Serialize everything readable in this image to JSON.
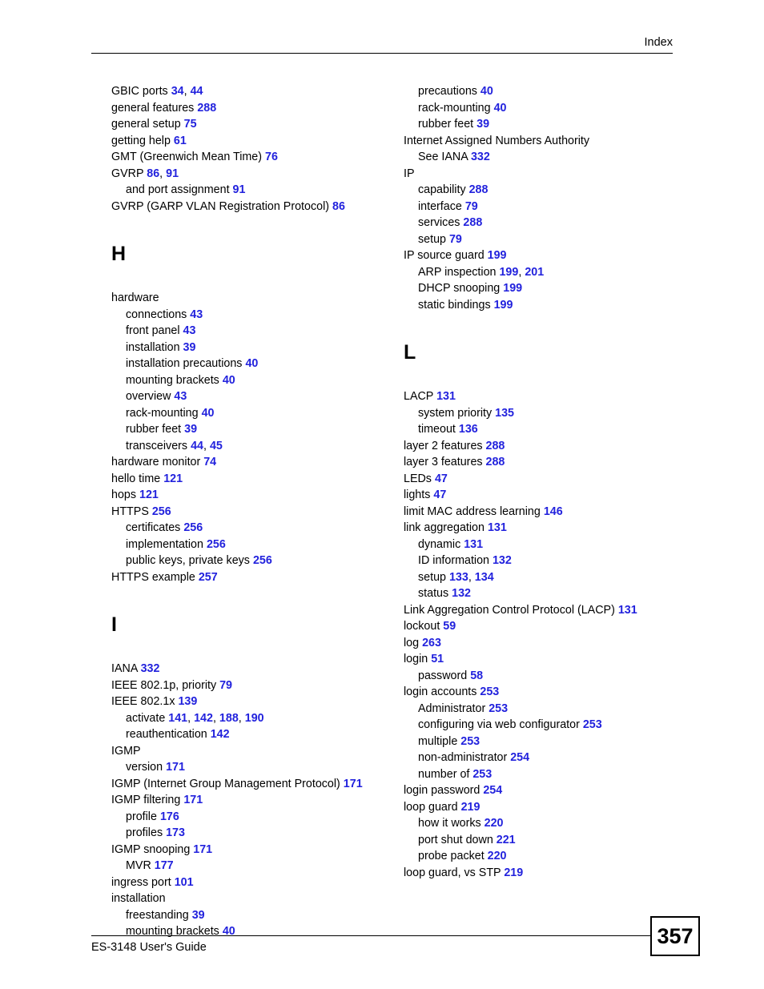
{
  "header": {
    "title": "Index"
  },
  "footer": {
    "guide_title": "ES-3148 User's Guide",
    "page_number": "357"
  },
  "colors": {
    "page_link": "#2222dd",
    "text": "#000000",
    "background": "#ffffff"
  },
  "columns": {
    "left": [
      {
        "type": "entries",
        "entries": [
          {
            "level": 0,
            "label": "GBIC ports",
            "pages": "34, 44"
          },
          {
            "level": 0,
            "label": "general features",
            "pages": "288"
          },
          {
            "level": 0,
            "label": "general setup",
            "pages": "75"
          },
          {
            "level": 0,
            "label": "getting help",
            "pages": "61"
          },
          {
            "level": 0,
            "label": "GMT (Greenwich Mean Time)",
            "pages": "76"
          },
          {
            "level": 0,
            "label": "GVRP",
            "pages": "86, 91"
          },
          {
            "level": 1,
            "label": "and port assignment",
            "pages": "91"
          },
          {
            "level": 0,
            "label": "GVRP (GARP VLAN Registration Protocol)",
            "pages": "86"
          }
        ]
      },
      {
        "type": "letter",
        "letter": "H"
      },
      {
        "type": "entries",
        "entries": [
          {
            "level": 0,
            "label": "hardware",
            "pages": ""
          },
          {
            "level": 1,
            "label": "connections",
            "pages": "43"
          },
          {
            "level": 1,
            "label": "front panel",
            "pages": "43"
          },
          {
            "level": 1,
            "label": "installation",
            "pages": "39"
          },
          {
            "level": 1,
            "label": "installation precautions",
            "pages": "40"
          },
          {
            "level": 1,
            "label": "mounting brackets",
            "pages": "40"
          },
          {
            "level": 1,
            "label": "overview",
            "pages": "43"
          },
          {
            "level": 1,
            "label": "rack-mounting",
            "pages": "40"
          },
          {
            "level": 1,
            "label": "rubber feet",
            "pages": "39"
          },
          {
            "level": 1,
            "label": "transceivers",
            "pages": "44, 45"
          },
          {
            "level": 0,
            "label": "hardware monitor",
            "pages": "74"
          },
          {
            "level": 0,
            "label": "hello time",
            "pages": "121"
          },
          {
            "level": 0,
            "label": "hops",
            "pages": "121"
          },
          {
            "level": 0,
            "label": "HTTPS",
            "pages": "256"
          },
          {
            "level": 1,
            "label": "certificates",
            "pages": "256"
          },
          {
            "level": 1,
            "label": "implementation",
            "pages": "256"
          },
          {
            "level": 1,
            "label": "public keys, private keys",
            "pages": "256"
          },
          {
            "level": 0,
            "label": "HTTPS example",
            "pages": "257"
          }
        ]
      },
      {
        "type": "letter",
        "letter": "I"
      },
      {
        "type": "entries",
        "entries": [
          {
            "level": 0,
            "label": "IANA",
            "pages": "332"
          },
          {
            "level": 0,
            "label": "IEEE 802.1p, priority",
            "pages": "79"
          },
          {
            "level": 0,
            "label": "IEEE 802.1x",
            "pages": "139"
          },
          {
            "level": 1,
            "label": "activate",
            "pages": "141, 142, 188, 190"
          },
          {
            "level": 1,
            "label": "reauthentication",
            "pages": "142"
          },
          {
            "level": 0,
            "label": "IGMP",
            "pages": ""
          },
          {
            "level": 1,
            "label": "version",
            "pages": "171"
          },
          {
            "level": 0,
            "label": "IGMP (Internet Group Management Protocol)",
            "pages": "171"
          },
          {
            "level": 0,
            "label": "IGMP filtering",
            "pages": "171"
          },
          {
            "level": 1,
            "label": "profile",
            "pages": "176"
          },
          {
            "level": 1,
            "label": "profiles",
            "pages": "173"
          },
          {
            "level": 0,
            "label": "IGMP snooping",
            "pages": "171"
          },
          {
            "level": 1,
            "label": "MVR",
            "pages": "177"
          },
          {
            "level": 0,
            "label": "ingress port",
            "pages": "101"
          },
          {
            "level": 0,
            "label": "installation",
            "pages": ""
          },
          {
            "level": 1,
            "label": "freestanding",
            "pages": "39"
          },
          {
            "level": 1,
            "label": "mounting brackets",
            "pages": "40"
          }
        ]
      }
    ],
    "right": [
      {
        "type": "entries",
        "entries": [
          {
            "level": 1,
            "label": "precautions",
            "pages": "40"
          },
          {
            "level": 1,
            "label": "rack-mounting",
            "pages": "40"
          },
          {
            "level": 1,
            "label": "rubber feet",
            "pages": "39"
          },
          {
            "level": 0,
            "label": "Internet Assigned Numbers Authority",
            "pages": ""
          },
          {
            "level": 1,
            "label": "See IANA",
            "pages": "332"
          },
          {
            "level": 0,
            "label": "IP",
            "pages": ""
          },
          {
            "level": 1,
            "label": "capability",
            "pages": "288"
          },
          {
            "level": 1,
            "label": "interface",
            "pages": "79"
          },
          {
            "level": 1,
            "label": "services",
            "pages": "288"
          },
          {
            "level": 1,
            "label": "setup",
            "pages": "79"
          },
          {
            "level": 0,
            "label": "IP source guard",
            "pages": "199"
          },
          {
            "level": 1,
            "label": "ARP inspection",
            "pages": "199, 201"
          },
          {
            "level": 1,
            "label": "DHCP snooping",
            "pages": "199"
          },
          {
            "level": 1,
            "label": "static bindings",
            "pages": "199"
          }
        ]
      },
      {
        "type": "letter",
        "letter": "L"
      },
      {
        "type": "entries",
        "entries": [
          {
            "level": 0,
            "label": "LACP",
            "pages": "131"
          },
          {
            "level": 1,
            "label": "system priority",
            "pages": "135"
          },
          {
            "level": 1,
            "label": "timeout",
            "pages": "136"
          },
          {
            "level": 0,
            "label": "layer 2 features",
            "pages": "288"
          },
          {
            "level": 0,
            "label": "layer 3 features",
            "pages": "288"
          },
          {
            "level": 0,
            "label": "LEDs",
            "pages": "47"
          },
          {
            "level": 0,
            "label": "lights",
            "pages": "47"
          },
          {
            "level": 0,
            "label": "limit MAC address learning",
            "pages": "146"
          },
          {
            "level": 0,
            "label": "link aggregation",
            "pages": "131"
          },
          {
            "level": 1,
            "label": "dynamic",
            "pages": "131"
          },
          {
            "level": 1,
            "label": "ID information",
            "pages": "132"
          },
          {
            "level": 1,
            "label": "setup",
            "pages": "133, 134"
          },
          {
            "level": 1,
            "label": "status",
            "pages": "132"
          },
          {
            "level": 0,
            "label": "Link Aggregation Control Protocol (LACP)",
            "pages": "131"
          },
          {
            "level": 0,
            "label": "lockout",
            "pages": "59"
          },
          {
            "level": 0,
            "label": "log",
            "pages": "263"
          },
          {
            "level": 0,
            "label": "login",
            "pages": "51"
          },
          {
            "level": 1,
            "label": "password",
            "pages": "58"
          },
          {
            "level": 0,
            "label": "login accounts",
            "pages": "253"
          },
          {
            "level": 1,
            "label": "Administrator",
            "pages": "253"
          },
          {
            "level": 1,
            "label": "configuring via web configurator",
            "pages": "253"
          },
          {
            "level": 1,
            "label": "multiple",
            "pages": "253"
          },
          {
            "level": 1,
            "label": "non-administrator",
            "pages": "254"
          },
          {
            "level": 1,
            "label": "number of",
            "pages": "253"
          },
          {
            "level": 0,
            "label": "login password",
            "pages": "254"
          },
          {
            "level": 0,
            "label": "loop guard",
            "pages": "219"
          },
          {
            "level": 1,
            "label": "how it works",
            "pages": "220"
          },
          {
            "level": 1,
            "label": "port shut down",
            "pages": "221"
          },
          {
            "level": 1,
            "label": "probe packet",
            "pages": "220"
          },
          {
            "level": 0,
            "label": "loop guard, vs STP",
            "pages": "219"
          }
        ]
      }
    ]
  }
}
